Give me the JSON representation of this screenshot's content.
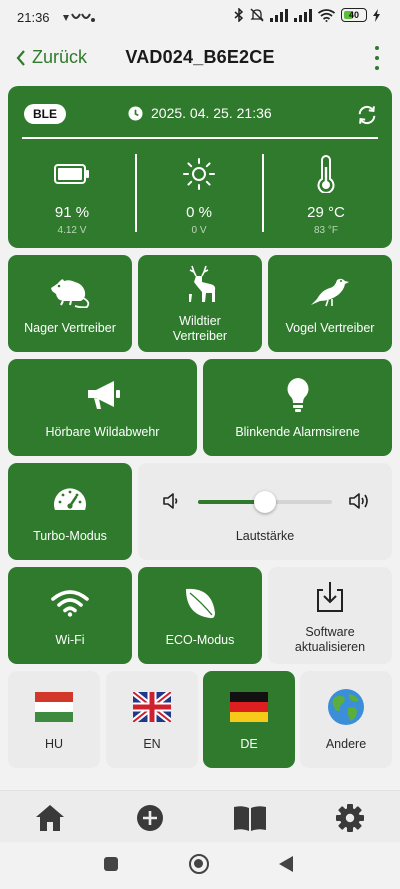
{
  "status_bar": {
    "time": "21:36",
    "battery_percent": "40"
  },
  "app_bar": {
    "back_label": "Zurück",
    "title": "VAD024_B6E2CE"
  },
  "status_card": {
    "connection_badge": "BLE",
    "datetime": "2025. 04. 25. 21:36",
    "battery": {
      "value": "91 %",
      "sub": "4.12 V"
    },
    "light": {
      "value": "0 %",
      "sub": "0 V"
    },
    "temperature": {
      "value": "29 °C",
      "sub": "83 °F"
    }
  },
  "modes": {
    "rodent": "Nager Vertreiber",
    "wildlife_line1": "Wildtier",
    "wildlife_line2": "Vertreiber",
    "bird": "Vogel Vertreiber",
    "audible": "Hörbare Wildabwehr",
    "flashing": "Blinkende Alarmsirene",
    "turbo": "Turbo-Modus",
    "wifi": "Wi-Fi",
    "eco": "ECO-Modus",
    "update_line1": "Software",
    "update_line2": "aktualisieren"
  },
  "volume": {
    "label": "Lautstärke",
    "level": 0.5
  },
  "languages": [
    {
      "code": "HU",
      "selected": false
    },
    {
      "code": "EN",
      "selected": false
    },
    {
      "code": "DE",
      "selected": true
    },
    {
      "code": "Andere",
      "selected": false
    }
  ],
  "colors": {
    "primary_green": "#2f7a2c",
    "tile_light": "#ebebeb",
    "background": "#f2f2f2"
  },
  "bottom_nav": [
    "home-icon",
    "add-circle-icon",
    "book-icon",
    "settings-icon"
  ]
}
